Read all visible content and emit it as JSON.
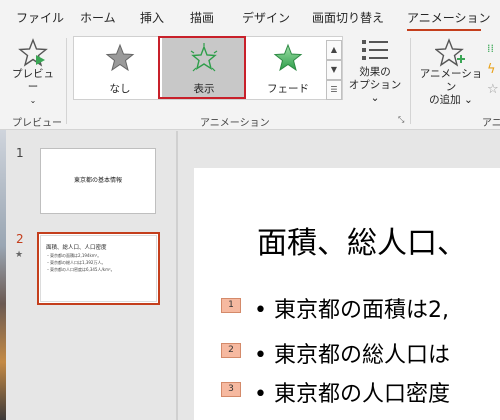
{
  "tabs": [
    {
      "label": "ファイル"
    },
    {
      "label": "ホーム"
    },
    {
      "label": "挿入"
    },
    {
      "label": "描画"
    },
    {
      "label": "デザイン"
    },
    {
      "label": "画面切り替え"
    },
    {
      "label": "アニメーション"
    }
  ],
  "active_tab_index": 6,
  "ribbon": {
    "preview_label": "プレビュー",
    "preview_group_label": "プレビュー",
    "animation_group_label": "アニメーション",
    "gallery": [
      {
        "label": "なし",
        "icon": "star-outline-icon"
      },
      {
        "label": "表示",
        "icon": "star-appear-icon",
        "selected": true
      },
      {
        "label": "フェード",
        "icon": "star-fade-icon"
      }
    ],
    "effect_options_line1": "効果の",
    "effect_options_line2": "オプション",
    "add_animation_line1": "アニメーション",
    "add_animation_line2": "の追加",
    "right_group_label_partial": "アニメ"
  },
  "slides": [
    {
      "number": "1",
      "title": "東京都の基本情報"
    },
    {
      "number": "2",
      "title": "面積、総人口、人口密度",
      "lines": [
        "・東京都の面積は2,194km²。",
        "・東京都の総人口は1,392万人。",
        "・東京都の人口密度は6,345人/km²。"
      ]
    }
  ],
  "current_slide": {
    "title": "面積、総人口、",
    "bullets": [
      {
        "tag": "1",
        "text": "• 東京都の面積は2,"
      },
      {
        "tag": "2",
        "text": "• 東京都の総人口は"
      },
      {
        "tag": "3",
        "text": "• 東京都の人口密度"
      }
    ]
  },
  "colors": {
    "accent": "#c43e1c",
    "selection_red": "#c8202a",
    "anim_tag": "#f6b9a0"
  }
}
